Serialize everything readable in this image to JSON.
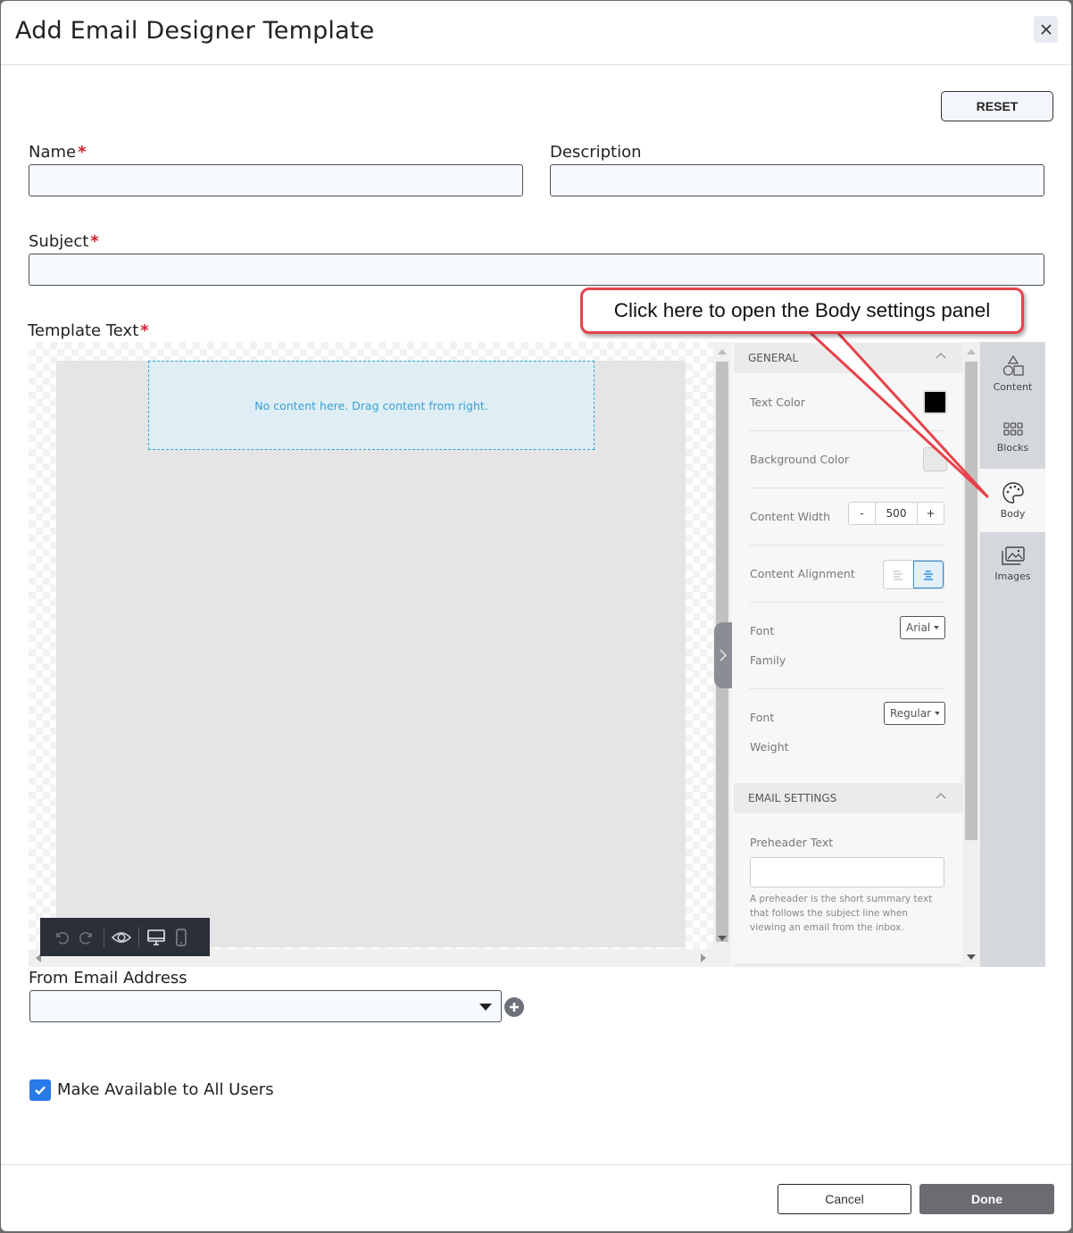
{
  "dialog": {
    "title": "Add Email Designer Template",
    "reset_label": "RESET",
    "close_icon": "close-icon"
  },
  "form": {
    "name": {
      "label": "Name",
      "required_mark": "*",
      "value": "",
      "placeholder": ""
    },
    "description": {
      "label": "Description",
      "value": "",
      "placeholder": ""
    },
    "subject": {
      "label": "Subject",
      "required_mark": "*",
      "value": "",
      "placeholder": ""
    },
    "template_text": {
      "label": "Template Text",
      "required_mark": "*"
    },
    "from_email": {
      "label": "From Email Address",
      "selected": ""
    },
    "make_available": {
      "label": "Make Available to All Users",
      "checked": true
    }
  },
  "editor": {
    "drop_zone_text": "No content here. Drag content from right.",
    "toolbar": [
      {
        "icon": "undo-icon"
      },
      {
        "icon": "redo-icon"
      },
      {
        "icon": "preview-eye-icon"
      },
      {
        "icon": "desktop-icon"
      },
      {
        "icon": "mobile-icon"
      }
    ],
    "settings": {
      "general_header": "GENERAL",
      "text_color_label": "Text Color",
      "text_color": "#000000",
      "background_color_label": "Background Color",
      "background_color": "#e8e8e8",
      "content_width_label": "Content Width",
      "content_width_minus": "-",
      "content_width_value": "500",
      "content_width_plus": "+",
      "content_alignment_label": "Content Alignment",
      "content_alignment": "center",
      "font_family_label_1": "Font",
      "font_family_label_2": "Family",
      "font_family_value": "Arial",
      "font_weight_label_1": "Font",
      "font_weight_label_2": "Weight",
      "font_weight_value": "Regular",
      "email_settings_header": "EMAIL SETTINGS",
      "preheader_label": "Preheader Text",
      "preheader_value": "",
      "preheader_help": "A preheader is the short summary text that follows the subject line when viewing an email from the inbox."
    },
    "tabs": [
      {
        "label": "Content",
        "icon": "shapes-icon",
        "active": false
      },
      {
        "label": "Blocks",
        "icon": "grid-icon",
        "active": false
      },
      {
        "label": "Body",
        "icon": "palette-icon",
        "active": true
      },
      {
        "label": "Images",
        "icon": "images-icon",
        "active": false
      }
    ]
  },
  "callout": {
    "text": "Click here to open the Body settings panel"
  },
  "footer": {
    "cancel_label": "Cancel",
    "done_label": "Done"
  },
  "colors": {
    "accent_blue": "#2979e8",
    "required_red": "#d0202f",
    "callout_red": "#e8424a",
    "done_gray": "#6b6c70"
  }
}
